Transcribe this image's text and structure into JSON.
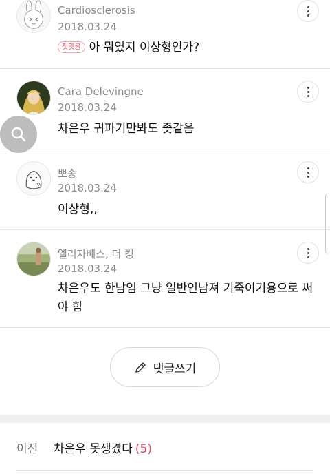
{
  "comments": [
    {
      "author": "Cardiosclerosis",
      "date": "2018.03.24",
      "badge": "첫댓글",
      "text": "아 뭐였지 이상형인가?",
      "avatar": "rabbit-avatar"
    },
    {
      "author": "Cara Delevingne",
      "date": "2018.03.24",
      "text": "차은우 귀파기만봐도 좆같음",
      "avatar": "portrait-avatar"
    },
    {
      "author": "뽀송",
      "date": "2018.03.24",
      "text": "이상형,,",
      "avatar": "seal-avatar"
    },
    {
      "author": "엘리자베스, 더 킹",
      "date": "2018.03.24",
      "text": "차은우도 한남임 그냥 일반인남져 기죽이기용으로 써야 함",
      "avatar": "photo-avatar"
    }
  ],
  "write_button": {
    "label": "댓글쓰기",
    "icon": "pencil-icon"
  },
  "prev_post": {
    "label": "이전",
    "title": "차은우 못생겼다",
    "count": "(5)"
  },
  "floating": {
    "icon": "search-icon"
  },
  "colors": {
    "accent": "#e0455a",
    "meta": "#8a8a8a",
    "divider": "#e6e6e6"
  }
}
